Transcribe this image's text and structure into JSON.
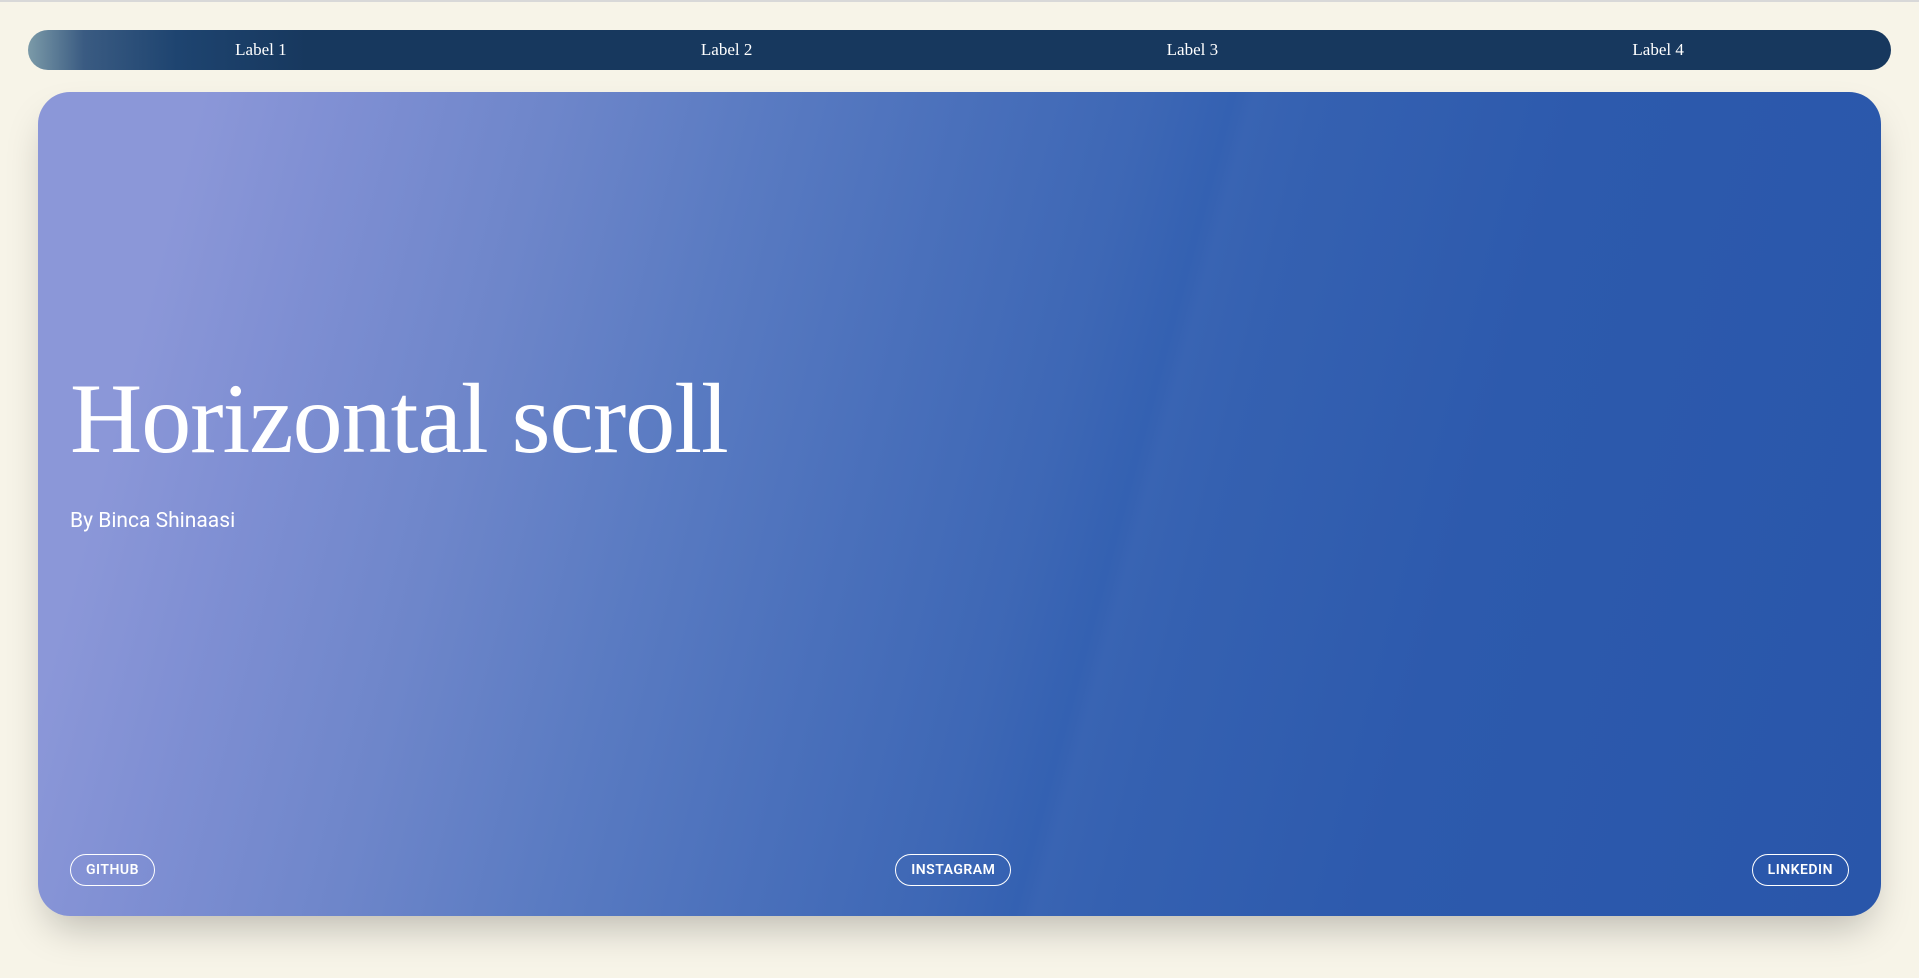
{
  "nav": {
    "items": [
      {
        "label": "Label 1"
      },
      {
        "label": "Label 2"
      },
      {
        "label": "Label 3"
      },
      {
        "label": "Label 4"
      }
    ]
  },
  "hero": {
    "title": "Horizontal scroll",
    "author": "By Binca Shinaasi"
  },
  "social": {
    "github": "GITHUB",
    "instagram": "INSTAGRAM",
    "linkedin": "LINKEDIN"
  }
}
